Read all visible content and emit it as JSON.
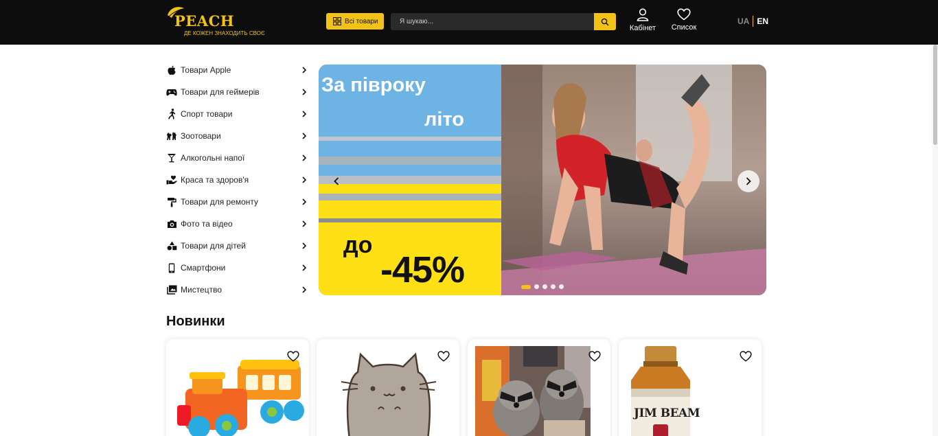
{
  "header": {
    "logo_text": "PEACH",
    "logo_tagline": "ДЕ КОЖЕН ЗНАХОДИТЬ СВОЄ",
    "all_goods_label": "Всі товари",
    "search_placeholder": "Я шукаю...",
    "cabinet_label": "Кабінет",
    "wishlist_label": "Список",
    "lang_ua": "UA",
    "lang_en": "EN"
  },
  "colors": {
    "brand_yellow": "#f2c316",
    "header_bg": "#0d0d0d",
    "banner_blue": "#6db3e4",
    "banner_yellow": "#ffdf16"
  },
  "sidebar": {
    "items": [
      {
        "label": "Товари Apple",
        "icon": "apple-icon"
      },
      {
        "label": "Товари для геймерів",
        "icon": "gamepad-icon"
      },
      {
        "label": "Спорт товари",
        "icon": "runner-icon"
      },
      {
        "label": "Зоотовари",
        "icon": "pets-icon"
      },
      {
        "label": "Алкогольні напої",
        "icon": "cocktail-icon"
      },
      {
        "label": "Краса та здоров'я",
        "icon": "hand-heart-icon"
      },
      {
        "label": "Товари для ремонту",
        "icon": "paint-roller-icon"
      },
      {
        "label": "Фото та відео",
        "icon": "camera-icon"
      },
      {
        "label": "Товари для дітей",
        "icon": "shapes-icon"
      },
      {
        "label": "Смартфони",
        "icon": "smartphone-icon"
      },
      {
        "label": "Мистецтво",
        "icon": "gallery-icon"
      }
    ]
  },
  "banner": {
    "line1": "За півроку",
    "line2": "літо",
    "line3": "до",
    "discount": "-45%",
    "slides_count": 5,
    "active_slide": 1
  },
  "new_section": {
    "title": "Новинки",
    "products": [
      {
        "image": "toy-train"
      },
      {
        "image": "pusheen-cat"
      },
      {
        "image": "raccoons"
      },
      {
        "image": "jim-beam-bottle",
        "image_text": "JIM BEAM"
      }
    ]
  }
}
